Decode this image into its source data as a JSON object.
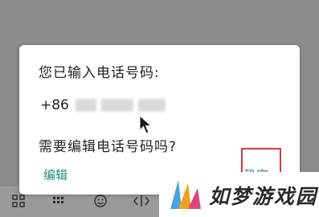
{
  "dialog": {
    "title": "您已输入电话号码:",
    "phone_prefix": "+86",
    "question": "需要编辑电话号码吗?",
    "edit_label": "编辑",
    "confirm_label": "确定"
  },
  "watermark": {
    "text": "如梦游戏园"
  },
  "keyboard": {
    "icons": [
      "grid-icon",
      "keypad-icon",
      "emoji-icon",
      "cursor-move-icon"
    ]
  },
  "colors": {
    "accent": "#1d8a78",
    "highlight": "#d43a3a",
    "overlay": "#8c8c8c"
  }
}
